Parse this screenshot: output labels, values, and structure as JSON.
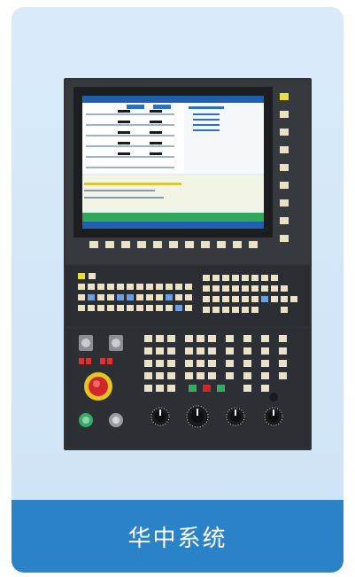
{
  "card": {
    "title": "华中系统"
  },
  "photo": {
    "subject": "cnc-control-panel",
    "colors": {
      "panel": "#33363a",
      "screen_bg": "#e8eef4",
      "screen_header": "#1f5fae",
      "key_cream": "#e9e2c8",
      "key_blue": "#6e9fdc",
      "estop_red": "#d2262b",
      "estop_yellow": "#e7c520",
      "led_red": "#e23030",
      "green_button": "#3aa86a",
      "footer": "#2b83c7"
    }
  }
}
